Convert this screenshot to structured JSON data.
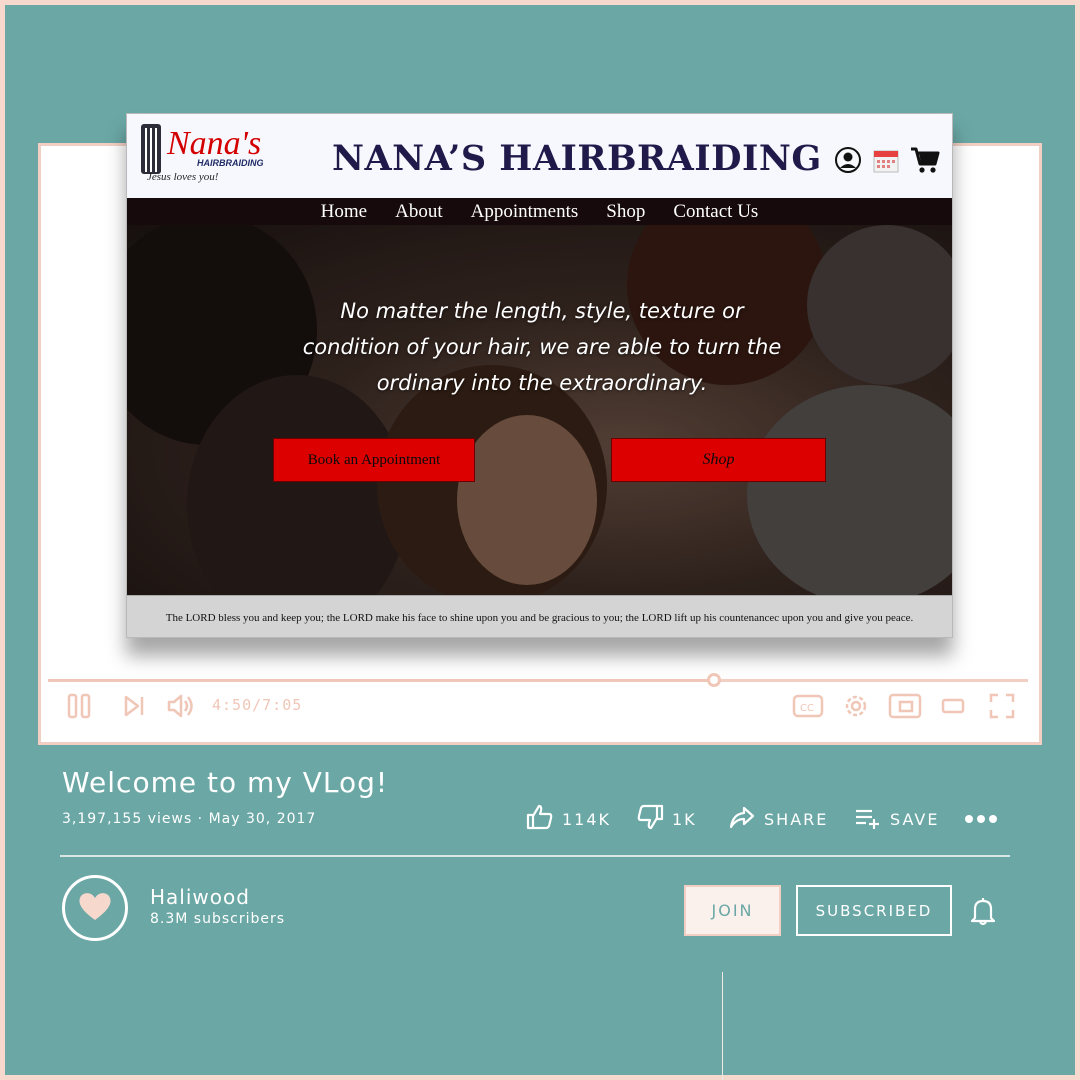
{
  "site": {
    "logo_title": "Nana's",
    "logo_sub": "HAIRBRAIDING",
    "logo_tagline": "Jesus loves you!",
    "title": "NANA’S HAIRBRAIDING",
    "nav": [
      "Home",
      "About",
      "Appointments",
      "Shop",
      "Contact Us"
    ],
    "hero_text": "No matter the length, style, texture or condition of your hair, we are able to turn the ordinary into the extraordinary.",
    "book_button": "Book an Appointment",
    "shop_button": "Shop",
    "footer_verse": "The LORD bless you and keep you; the LORD make his face to shine upon you and be gracious to you; the LORD lift up his countenancec upon you and give you peace."
  },
  "player": {
    "time": "4:50/7:05",
    "progress": 0.68,
    "controls": [
      "pause-icon",
      "next-icon",
      "volume-icon",
      "captions-icon",
      "settings-icon",
      "miniplayer-icon",
      "theater-icon",
      "fullscreen-icon"
    ]
  },
  "video": {
    "title": "Welcome to my VLog!",
    "meta": "3,197,155 views · May 30, 2017",
    "likes": "114K",
    "dislikes": "1K",
    "share": "SHARE",
    "save": "SAVE"
  },
  "channel": {
    "name": "Haliwood",
    "subscribers": "8.3M subscribers",
    "join": "JOIN",
    "subscribed": "SUBSCRIBED"
  },
  "colors": {
    "teal": "#6aa7a5",
    "peach": "#f3cfc3",
    "red_button": "#dc0000",
    "title_navy": "#1f1a4a"
  }
}
